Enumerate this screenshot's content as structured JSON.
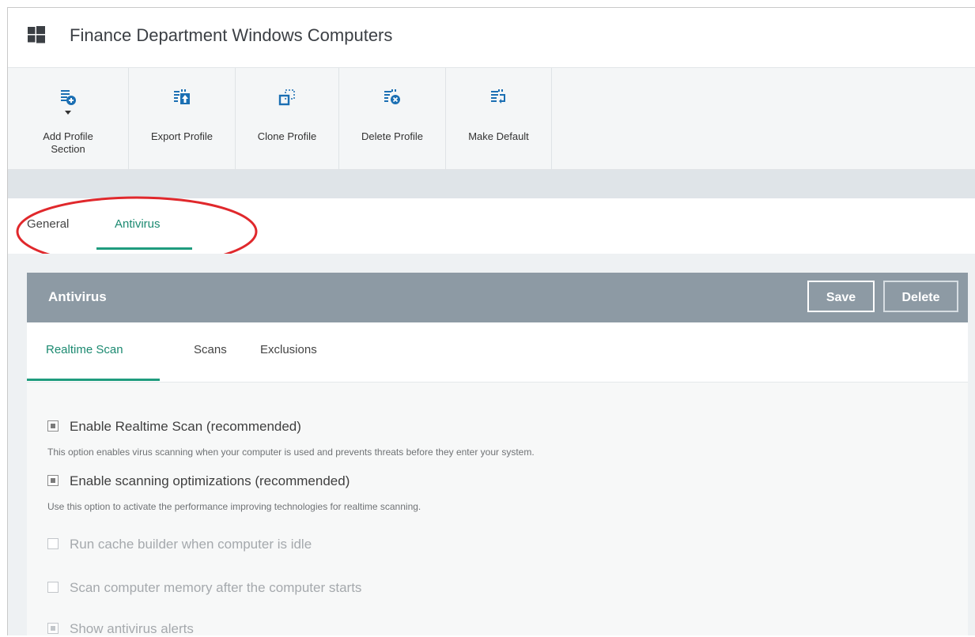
{
  "window": {
    "title": "Finance Department Windows Computers"
  },
  "toolbar": {
    "buttons": [
      {
        "label": "Add Profile Section",
        "icon": "add-profile-section-icon"
      },
      {
        "label": "Export Profile",
        "icon": "export-profile-icon"
      },
      {
        "label": "Clone Profile",
        "icon": "clone-profile-icon"
      },
      {
        "label": "Delete Profile",
        "icon": "delete-profile-icon"
      },
      {
        "label": "Make Default",
        "icon": "make-default-icon"
      }
    ]
  },
  "profile_tabs": [
    {
      "label": "General",
      "active": false
    },
    {
      "label": "Antivirus",
      "active": true
    }
  ],
  "panel": {
    "title": "Antivirus",
    "save_label": "Save",
    "delete_label": "Delete",
    "subtabs": [
      {
        "label": "Realtime Scan",
        "active": true
      },
      {
        "label": "Scans",
        "active": false
      },
      {
        "label": "Exclusions",
        "active": false
      }
    ],
    "options": [
      {
        "label": "Enable Realtime Scan (recommended)",
        "checked": true,
        "enabled": true,
        "description": "This option enables virus scanning when your computer is used and prevents threats before they enter your system."
      },
      {
        "label": "Enable scanning optimizations (recommended)",
        "checked": true,
        "enabled": true,
        "description": "Use this option to activate the performance improving technologies for realtime scanning."
      },
      {
        "label": "Run cache builder when computer is idle",
        "checked": false,
        "enabled": false
      },
      {
        "label": "Scan computer memory after the computer starts",
        "checked": false,
        "enabled": false
      },
      {
        "label": "Show antivirus alerts",
        "checked": true,
        "enabled": false
      }
    ]
  },
  "colors": {
    "accent": "#1f9c7e",
    "panel_header": "#8d9aa4",
    "highlight_ellipse": "#e0282c"
  }
}
